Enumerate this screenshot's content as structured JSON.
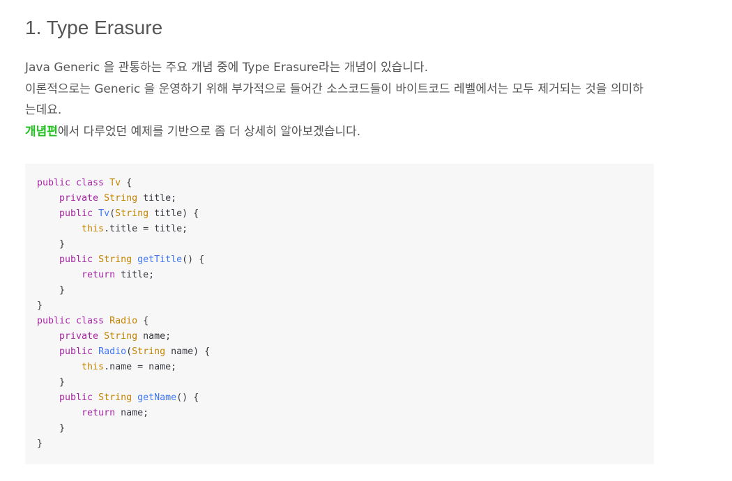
{
  "heading": "1. Type Erasure",
  "paragraph": {
    "line1": "Java Generic 을 관통하는 주요 개념 중에 Type Erasure라는 개념이 있습니다.",
    "line2": "이론적으로는 Generic 을 운영하기 위해 부가적으로 들어간 소스코드들이 바이트코드 레벨에서는 모두 제거되는 것을 의미하",
    "line3": "는데요.",
    "link_text": "개념편",
    "line4_rest": "에서 다루었던 예제를 기반으로 좀 더 상세히 알아보겠습니다."
  },
  "code": {
    "lines": [
      [
        {
          "t": "public class ",
          "c": "kw"
        },
        {
          "t": "Tv",
          "c": "ty"
        },
        {
          "t": " {",
          "c": "pl"
        }
      ],
      [
        {
          "t": "    private ",
          "c": "kw"
        },
        {
          "t": "String",
          "c": "ty"
        },
        {
          "t": " title;",
          "c": "pl"
        }
      ],
      [
        {
          "t": "    public ",
          "c": "kw"
        },
        {
          "t": "Tv",
          "c": "fn"
        },
        {
          "t": "(",
          "c": "pl"
        },
        {
          "t": "String",
          "c": "ty"
        },
        {
          "t": " title) {",
          "c": "pl"
        }
      ],
      [
        {
          "t": "        this",
          "c": "ty"
        },
        {
          "t": ".title = title;",
          "c": "pl"
        }
      ],
      [
        {
          "t": "    }",
          "c": "pl"
        }
      ],
      [
        {
          "t": "    public ",
          "c": "kw"
        },
        {
          "t": "String",
          "c": "ty"
        },
        {
          "t": " ",
          "c": "pl"
        },
        {
          "t": "getTitle",
          "c": "fn"
        },
        {
          "t": "() {",
          "c": "pl"
        }
      ],
      [
        {
          "t": "        return",
          "c": "kw"
        },
        {
          "t": " title;",
          "c": "pl"
        }
      ],
      [
        {
          "t": "    }",
          "c": "pl"
        }
      ],
      [
        {
          "t": "}",
          "c": "pl"
        }
      ],
      [
        {
          "t": "public class ",
          "c": "kw"
        },
        {
          "t": "Radio",
          "c": "ty"
        },
        {
          "t": " {",
          "c": "pl"
        }
      ],
      [
        {
          "t": "    private ",
          "c": "kw"
        },
        {
          "t": "String",
          "c": "ty"
        },
        {
          "t": " name;",
          "c": "pl"
        }
      ],
      [
        {
          "t": "    public ",
          "c": "kw"
        },
        {
          "t": "Radio",
          "c": "fn"
        },
        {
          "t": "(",
          "c": "pl"
        },
        {
          "t": "String",
          "c": "ty"
        },
        {
          "t": " name) {",
          "c": "pl"
        }
      ],
      [
        {
          "t": "        this",
          "c": "ty"
        },
        {
          "t": ".name = name;",
          "c": "pl"
        }
      ],
      [
        {
          "t": "    }",
          "c": "pl"
        }
      ],
      [
        {
          "t": "    public ",
          "c": "kw"
        },
        {
          "t": "String",
          "c": "ty"
        },
        {
          "t": " ",
          "c": "pl"
        },
        {
          "t": "getName",
          "c": "fn"
        },
        {
          "t": "() {",
          "c": "pl"
        }
      ],
      [
        {
          "t": "        return",
          "c": "kw"
        },
        {
          "t": " name;",
          "c": "pl"
        }
      ],
      [
        {
          "t": "    }",
          "c": "pl"
        }
      ],
      [
        {
          "t": "}",
          "c": "pl"
        }
      ]
    ]
  },
  "colors": {
    "text": "#555555",
    "link": "#22c01f",
    "code_background": "#f7f7f7",
    "keyword": "#a626a4",
    "type": "#c18401",
    "function": "#4078f2"
  }
}
